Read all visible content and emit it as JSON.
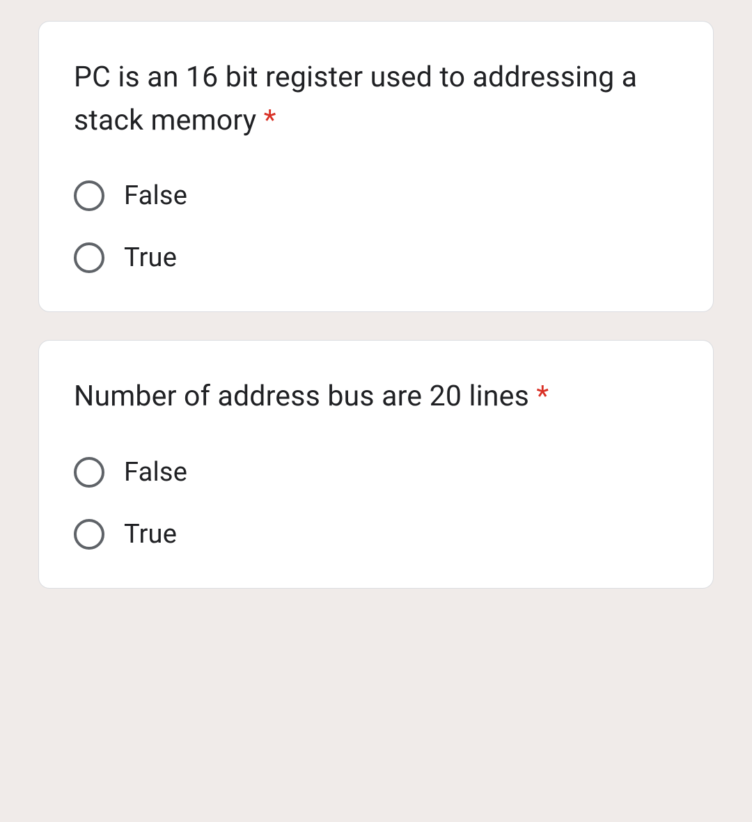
{
  "questions": [
    {
      "text": "PC is an 16 bit register used to addressing a stack memory ",
      "required": "*",
      "options": [
        {
          "label": "False"
        },
        {
          "label": "True"
        }
      ]
    },
    {
      "text": "Number of address bus are 20 lines ",
      "required": "*",
      "options": [
        {
          "label": "False"
        },
        {
          "label": "True"
        }
      ]
    }
  ]
}
